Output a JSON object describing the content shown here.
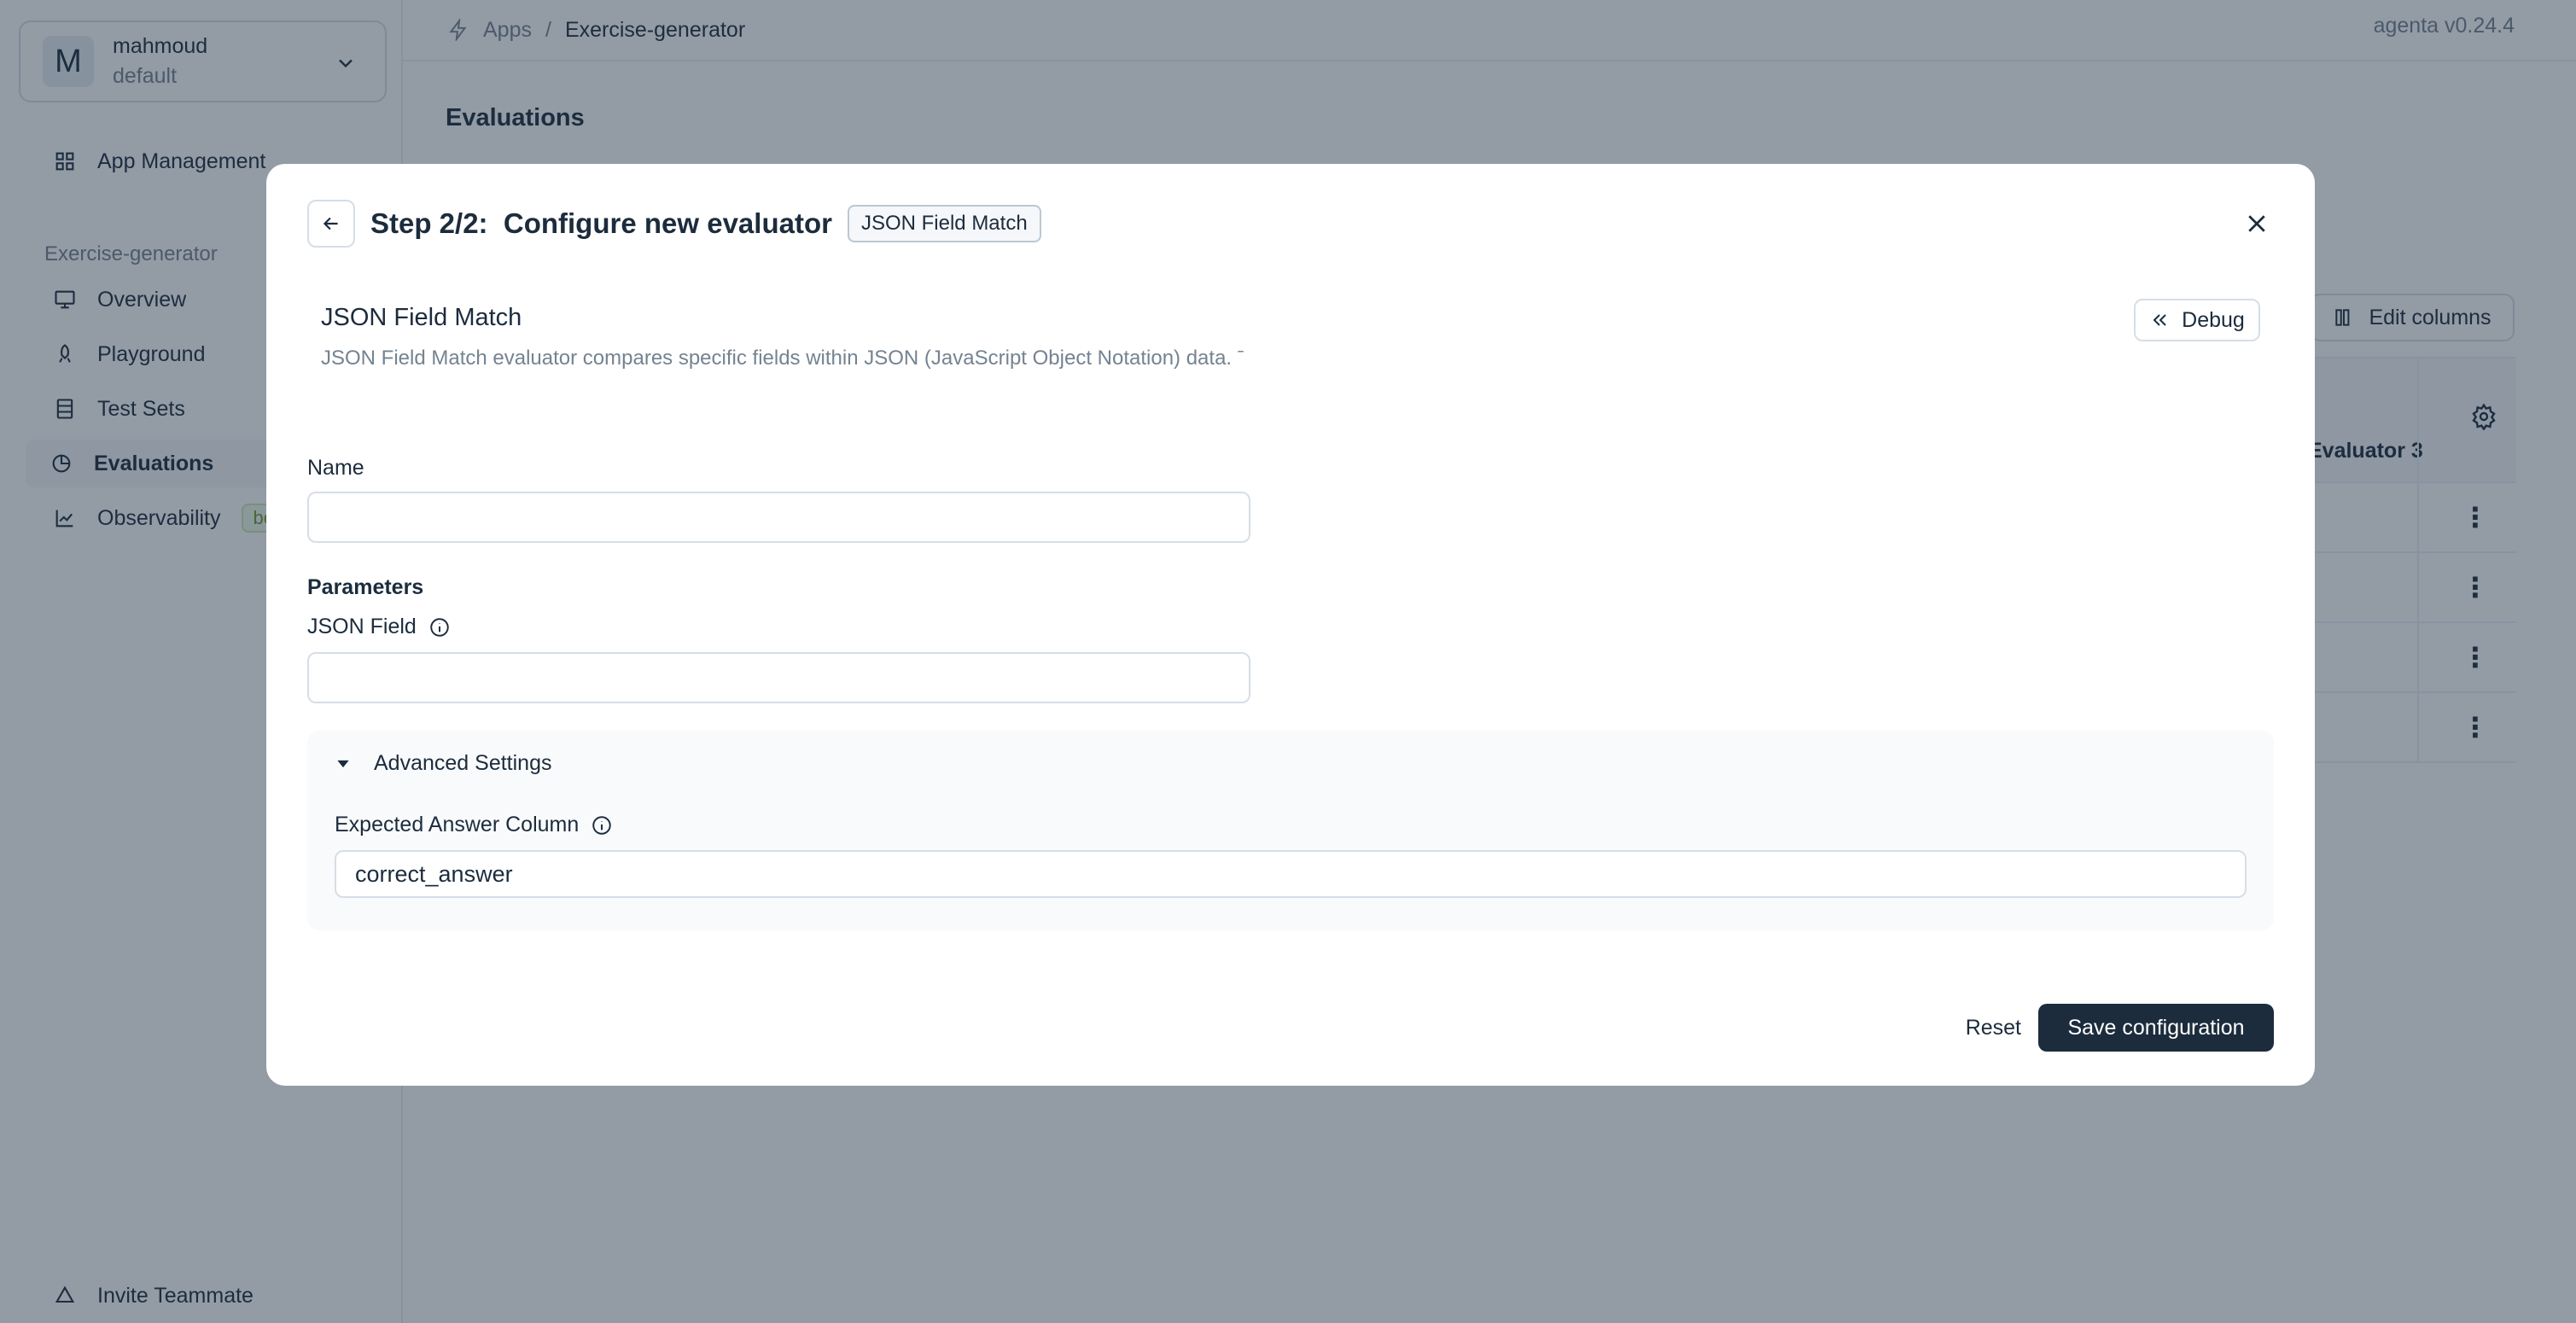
{
  "org": {
    "avatar_letter": "M",
    "name": "mahmoud",
    "workspace": "default"
  },
  "sidebar": {
    "app_management": "App Management",
    "section_title": "Exercise-generator",
    "items": [
      {
        "label": "Overview",
        "icon": "monitor-icon"
      },
      {
        "label": "Playground",
        "icon": "rocket-icon"
      },
      {
        "label": "Test Sets",
        "icon": "database-icon"
      },
      {
        "label": "Evaluations",
        "icon": "chart-pie-icon"
      },
      {
        "label": "Observability",
        "icon": "line-chart-icon",
        "badge": "be"
      }
    ],
    "invite": "Invite Teammate"
  },
  "breadcrumb": {
    "root": "Apps",
    "separator": "/",
    "current": "Exercise-generator"
  },
  "version": "agenta v0.24.4",
  "page": {
    "title": "Evaluations"
  },
  "table": {
    "edit_columns_label": "Edit columns",
    "visible_header": "Evaluator 3",
    "row_count_icon": "more-vertical-icon"
  },
  "modal": {
    "title": "Step 2/2:  Configure new evaluator",
    "tag": "JSON Field Match",
    "evaluator_name": "JSON Field Match",
    "evaluator_description": "JSON Field Match evaluator compares specific fields within JSON (JavaScript Object Notation) data. ˉ",
    "debug_label": "Debug",
    "name_label": "Name",
    "name_value": "",
    "parameters_label": "Parameters",
    "json_field_label": "JSON Field",
    "json_field_value": "",
    "advanced_label": "Advanced Settings",
    "expected_column_label": "Expected Answer Column",
    "expected_column_value": "correct_answer",
    "reset_label": "Reset",
    "save_label": "Save configuration"
  },
  "colors": {
    "primary": "#1c2c3d",
    "muted": "#758391",
    "border": "#d6dee6",
    "overlay": "rgba(30,47,67,0.48)"
  }
}
